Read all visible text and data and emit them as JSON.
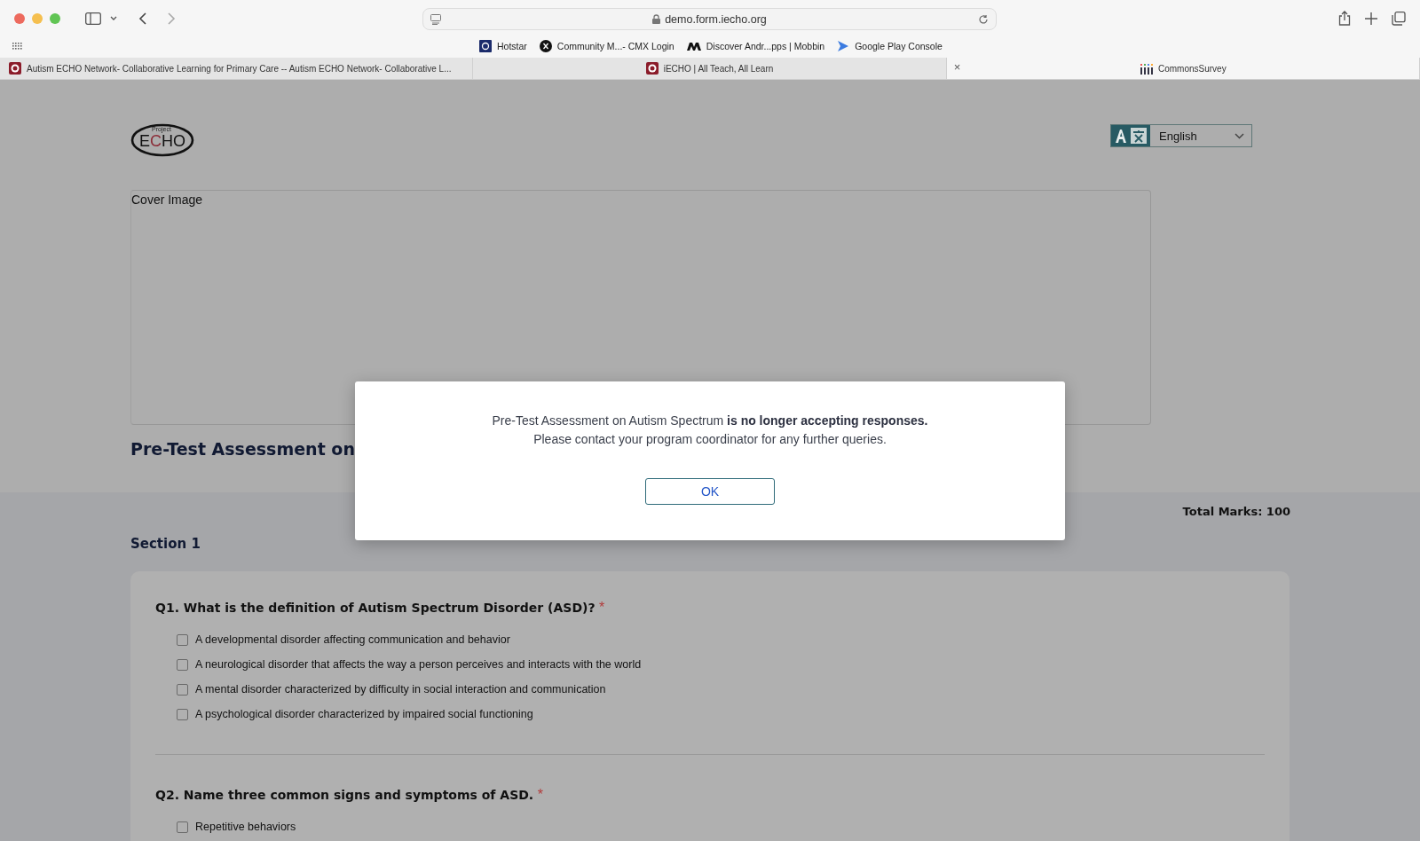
{
  "browser": {
    "url": "demo.form.iecho.org",
    "bookmarks": [
      {
        "label": "Hotstar",
        "kind": "hotstar"
      },
      {
        "label": "Community M...- CMX Login",
        "kind": "x"
      },
      {
        "label": "Discover Andr...pps | Mobbin",
        "kind": "mobbin"
      },
      {
        "label": "Google Play Console",
        "kind": "play"
      }
    ],
    "tabs": [
      {
        "title": "Autism ECHO Network- Collaborative Learning for Primary Care -- Autism ECHO Network- Collaborative L...",
        "kind": "echo",
        "selected": false
      },
      {
        "title": "iECHO | All Teach, All Learn",
        "kind": "echo",
        "selected": false
      },
      {
        "title": "CommonsSurvey",
        "kind": "survey",
        "selected": true
      }
    ],
    "tab_close": "×"
  },
  "page": {
    "logo": {
      "small": "Project",
      "main_start": "E",
      "main_accent": "C",
      "main_end": "HO"
    },
    "language": {
      "value": "English"
    },
    "cover_label": "Cover Image",
    "form_title": "Pre-Test Assessment on",
    "total_marks": "Total Marks: 100",
    "section_title": "Section 1",
    "questions": [
      {
        "text": "Q1. What is the definition of Autism Spectrum Disorder (ASD)?",
        "required": true,
        "options": [
          {
            "label": "A developmental disorder affecting communication and behavior",
            "checked": false
          },
          {
            "label": "A neurological disorder that affects the way a person perceives and interacts with the world",
            "checked": false
          },
          {
            "label": "A mental disorder characterized by difficulty in social interaction and communication",
            "checked": false
          },
          {
            "label": "A psychological disorder characterized by impaired social functioning",
            "checked": false
          }
        ]
      },
      {
        "text": "Q2. Name three common signs and symptoms of ASD.",
        "required": true,
        "options": [
          {
            "label": "Repetitive behaviors",
            "checked": false
          }
        ]
      }
    ],
    "required_mark": "*"
  },
  "dialog": {
    "line_1": "Pre-Test Assessment on Autism Spectrum **is no longer accepting responses.**",
    "line_2": "Please contact your program coordinator for any further queries.",
    "button": "OK"
  }
}
